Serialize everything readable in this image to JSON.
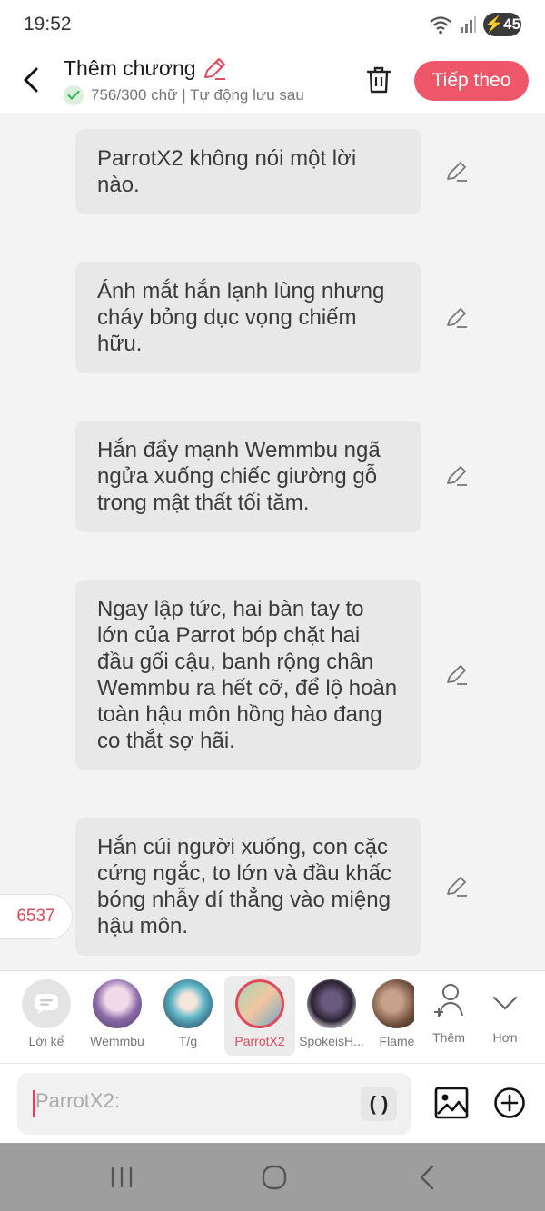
{
  "status": {
    "time": "19:52",
    "battery": "45"
  },
  "header": {
    "title": "Thêm chương",
    "subtitle": "756/300 chữ | Tự động lưu sau",
    "next_label": "Tiếp theo"
  },
  "messages": [
    "ParrotX2 không nói một lời nào.",
    "Ánh mắt hắn lạnh lùng nhưng cháy bỏng dục vọng chiếm hữu.",
    "Hắn đẩy mạnh Wemmbu ngã ngửa xuống chiếc giường gỗ trong mật thất tối tăm.",
    "Ngay lập tức, hai bàn tay to lớn của Parrot bóp chặt hai đầu gối cậu, banh rộng chân Wemmbu ra hết cỡ, để lộ hoàn toàn hậu môn hồng hào đang co thắt sợ hãi.",
    "Hắn cúi người xuống, con cặc cứng ngắc, to lớn và đầu khấc bóng nhẫy dí thẳng vào miệng hậu môn."
  ],
  "count_badge": "6537",
  "characters": [
    {
      "label": "Lời kể",
      "icon": "narration-icon"
    },
    {
      "label": "Wemmbu",
      "icon": "avatar"
    },
    {
      "label": "T/g",
      "icon": "avatar"
    },
    {
      "label": "ParrotX2",
      "icon": "avatar",
      "selected": true
    },
    {
      "label": "SpokeisH...",
      "icon": "avatar"
    },
    {
      "label": "Flame",
      "icon": "avatar"
    },
    {
      "label": "Thêm",
      "icon": "add-person-icon"
    },
    {
      "label": "Hơn",
      "icon": "chevron-down-icon"
    }
  ],
  "input": {
    "placeholder": "ParrotX2:",
    "paren_label": "( )"
  },
  "colors": {
    "accent": "#f0566a",
    "bubble": "#e8e8e8",
    "background": "#f3f3f3"
  }
}
